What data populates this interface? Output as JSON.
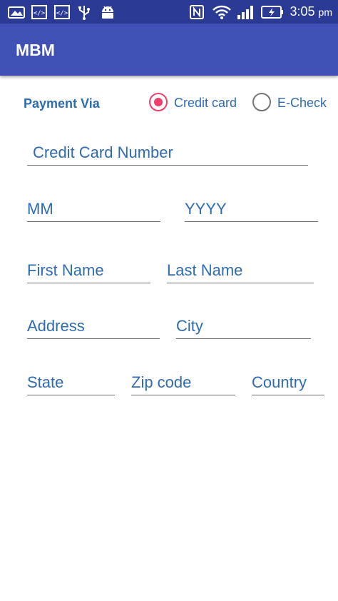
{
  "status_bar": {
    "icons": [
      "image-icon",
      "code-icon",
      "code-icon",
      "usb-icon",
      "android-icon",
      "nfc-icon",
      "wifi-icon",
      "signal-icon",
      "battery-charging-icon"
    ],
    "time": "3:05",
    "time_suffix": "pm"
  },
  "app_bar": {
    "title": "MBM"
  },
  "payment": {
    "label": "Payment Via",
    "options": [
      {
        "label": "Credit card",
        "selected": true
      },
      {
        "label": "E-Check",
        "selected": false
      }
    ]
  },
  "form": {
    "card_number": {
      "placeholder": "Credit Card Number",
      "value": ""
    },
    "month": {
      "placeholder": "MM",
      "value": ""
    },
    "year": {
      "placeholder": "YYYY",
      "value": ""
    },
    "first_name": {
      "placeholder": "First Name",
      "value": ""
    },
    "last_name": {
      "placeholder": "Last Name",
      "value": ""
    },
    "address": {
      "placeholder": "Address",
      "value": ""
    },
    "city": {
      "placeholder": "City",
      "value": ""
    },
    "state": {
      "placeholder": "State",
      "value": ""
    },
    "zip": {
      "placeholder": "Zip code",
      "value": ""
    },
    "country": {
      "placeholder": "Country",
      "value": ""
    }
  },
  "colors": {
    "status_bar": "#2b3a94",
    "app_bar": "#3f51b5",
    "accent": "#ef3f6b",
    "text_blue": "#2e6bb0"
  }
}
